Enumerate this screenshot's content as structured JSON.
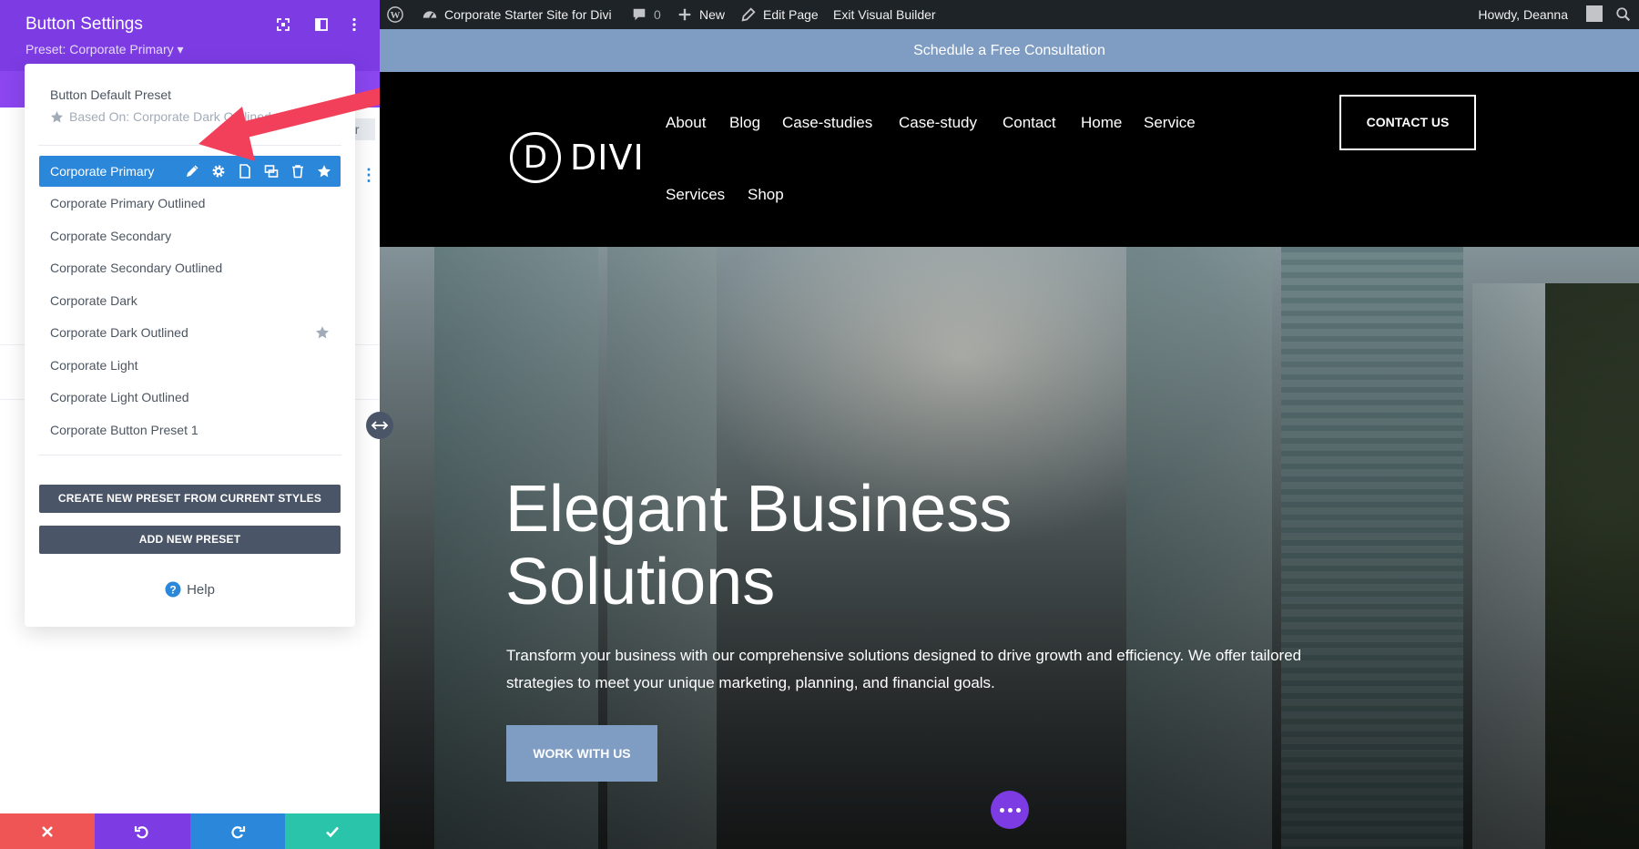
{
  "panel": {
    "title": "Button Settings",
    "preset_label": "Preset: Corporate Primary ▾",
    "behind_text": "er",
    "menu": {
      "default_preset": "Button Default Preset",
      "based_on": "Based On: Corporate Dark Outlined",
      "items": [
        {
          "label": "Corporate Primary",
          "active": true
        },
        {
          "label": "Corporate Primary Outlined"
        },
        {
          "label": "Corporate Secondary"
        },
        {
          "label": "Corporate Secondary Outlined"
        },
        {
          "label": "Corporate Dark"
        },
        {
          "label": "Corporate Dark Outlined",
          "starred": true
        },
        {
          "label": "Corporate Light"
        },
        {
          "label": "Corporate Light Outlined"
        },
        {
          "label": "Corporate Button Preset 1"
        }
      ],
      "create_button": "CREATE NEW PRESET FROM CURRENT STYLES",
      "add_button": "ADD NEW PRESET",
      "help": "Help"
    },
    "footer_colors": {
      "discard": "#ef5555",
      "undo": "#7d3be3",
      "redo": "#2b87da",
      "save": "#29c4a9"
    }
  },
  "adminbar": {
    "site_name": "Corporate Starter Site for Divi",
    "comments_count": "0",
    "new_label": "New",
    "edit_page": "Edit Page",
    "exit_builder": "Exit Visual Builder",
    "howdy": "Howdy, Deanna"
  },
  "site": {
    "topbar": "Schedule a Free Consultation",
    "logo_mark": "D",
    "logo_text": "DIVI",
    "nav": [
      "About",
      "Blog",
      "Case-studies",
      "Case-study",
      "Contact",
      "Home",
      "Service",
      "Services",
      "Shop"
    ],
    "contact_button": "CONTACT US",
    "hero": {
      "title_line1": "Elegant Business",
      "title_line2": "Solutions",
      "text": "Transform your business with our comprehensive solutions designed to drive growth and efficiency. We offer tailored strategies to meet your unique marketing, planning, and financial goals.",
      "button": "WORK WITH US"
    }
  },
  "colors": {
    "divi_purple": "#7d3be3",
    "active_blue": "#2b87da",
    "topbar_blue": "#7f9cc3",
    "annotation_red": "#f2405b"
  }
}
